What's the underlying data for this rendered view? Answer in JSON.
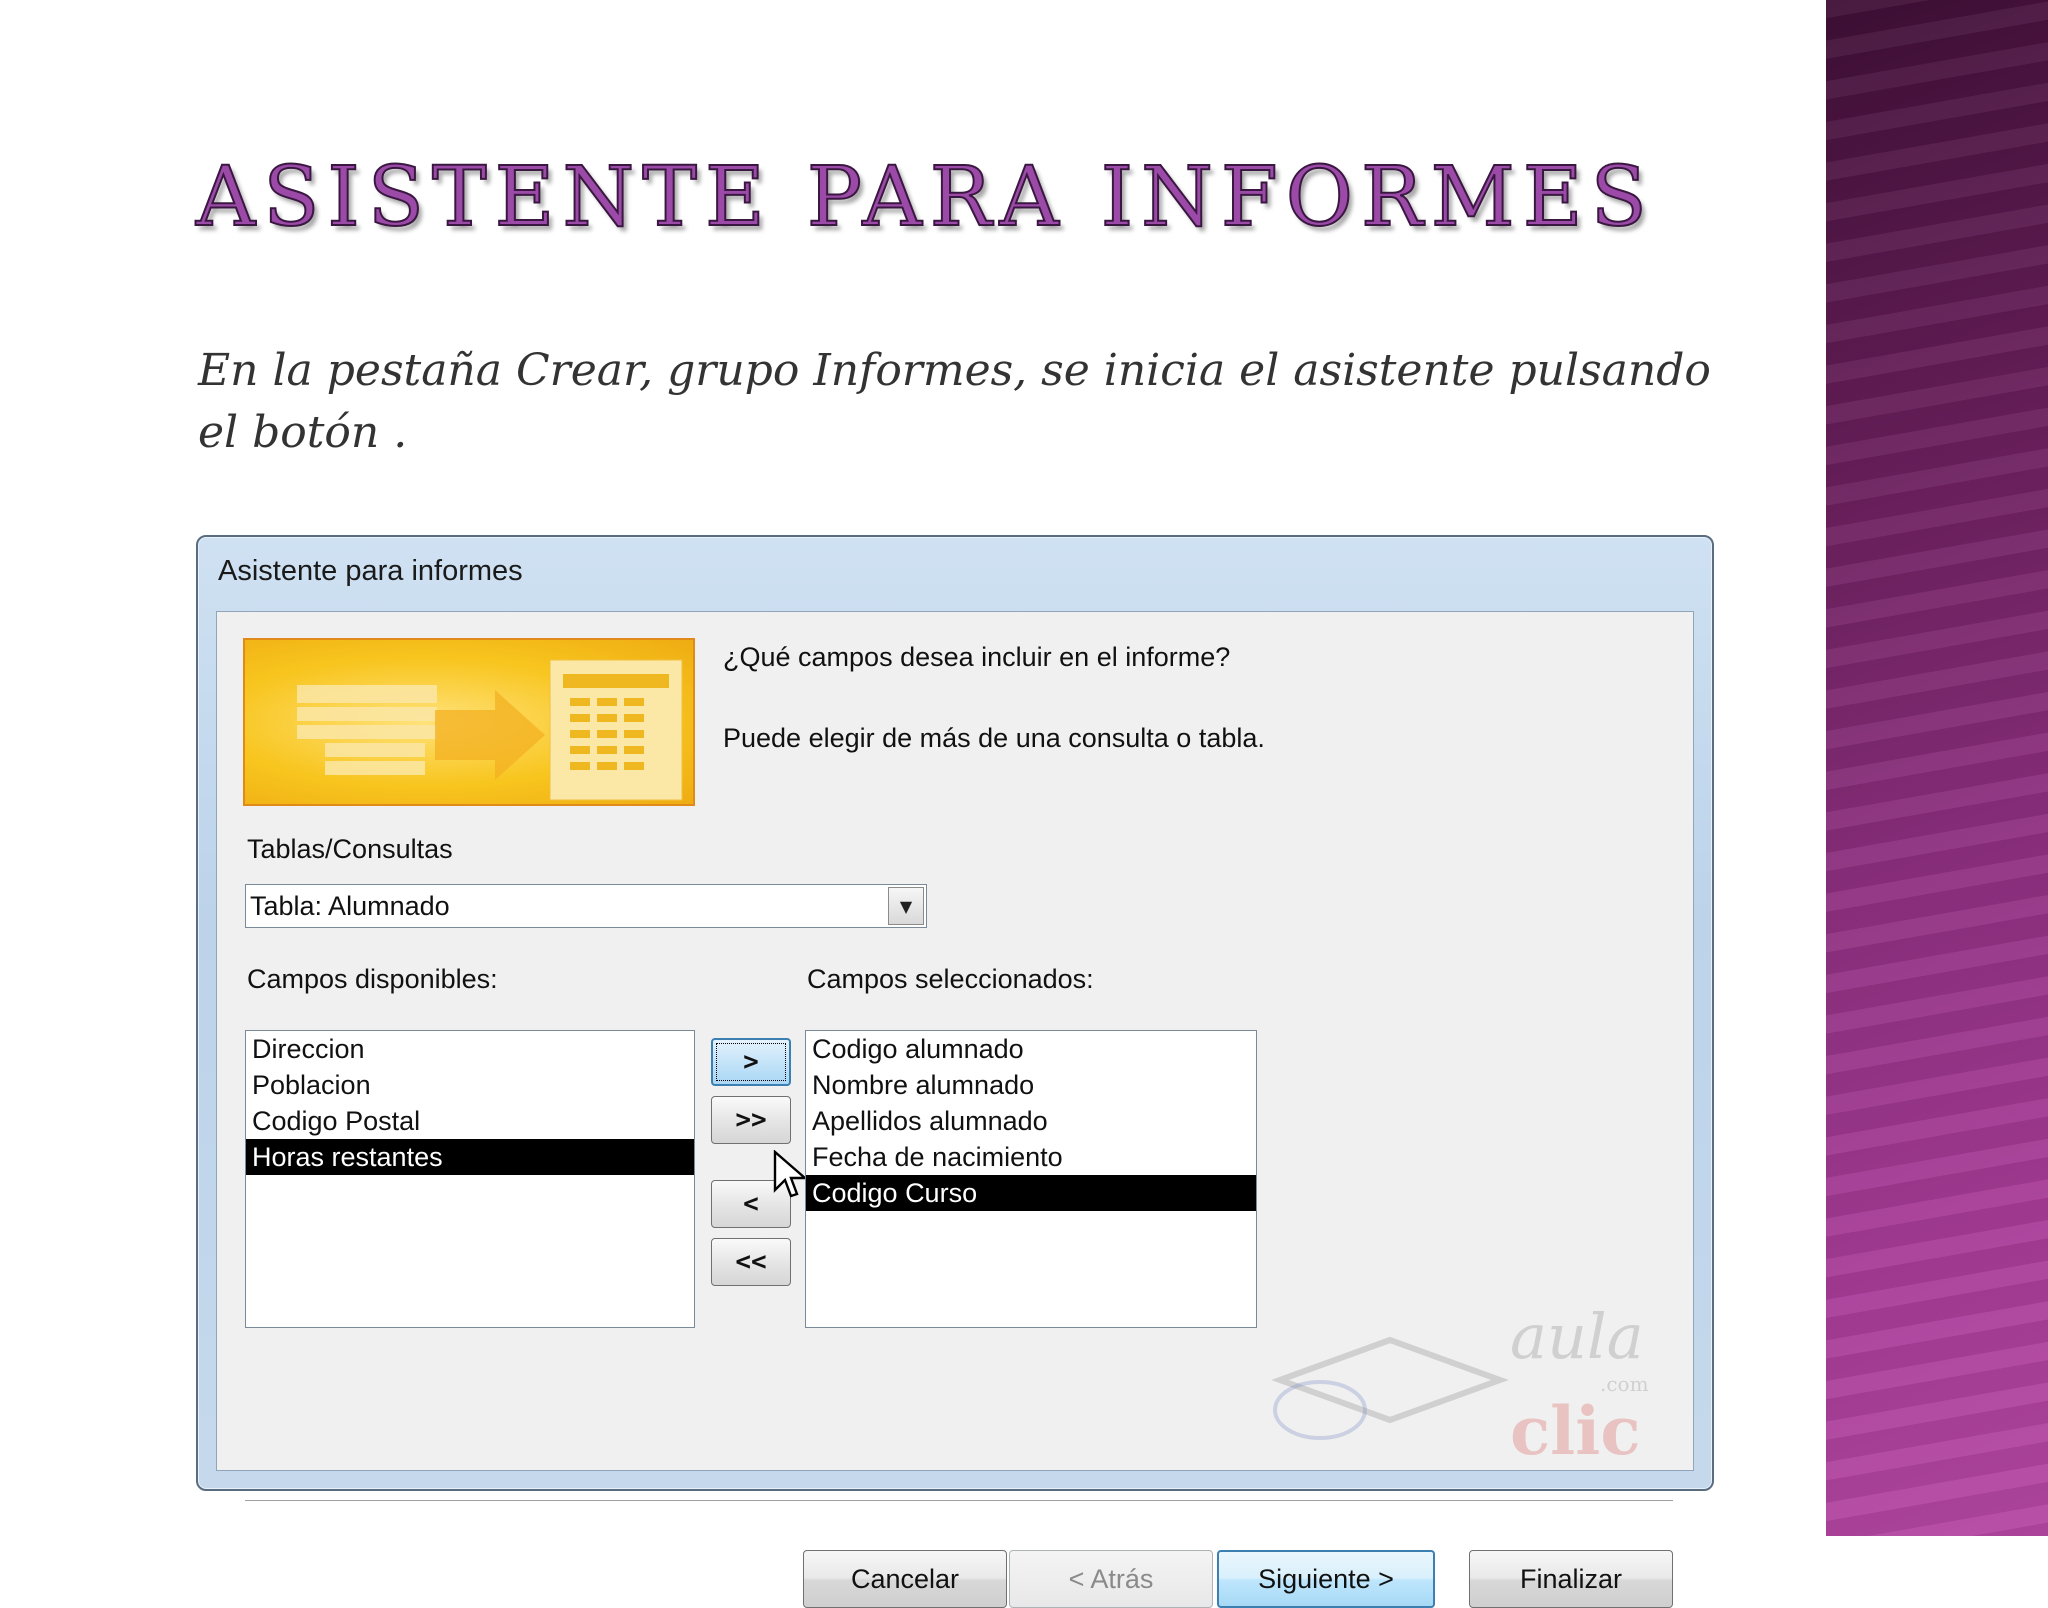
{
  "slide": {
    "title": "Asistente  para informes",
    "body": "En la pestaña Crear, grupo Informes, se inicia el asistente pulsando el botón ."
  },
  "dialog": {
    "title": "Asistente para informes",
    "question": "¿Qué campos desea incluir en el informe?",
    "hint": "Puede elegir de más de una consulta o tabla.",
    "tables_label": "Tablas/Consultas",
    "tables_value": "Tabla: Alumnado",
    "available_label": "Campos disponibles:",
    "selected_label": "Campos seleccionados:",
    "available_fields": [
      "Direccion",
      "Poblacion",
      "Codigo Postal",
      "Horas restantes"
    ],
    "available_selected_index": 3,
    "selected_fields": [
      "Codigo alumnado",
      "Nombre alumnado",
      "Apellidos alumnado",
      "Fecha de nacimiento",
      "Codigo Curso"
    ],
    "selected_selected_index": 4,
    "buttons": {
      "add_one": ">",
      "add_all": ">>",
      "remove_one": "<",
      "remove_all": "<<",
      "cancel": "Cancelar",
      "back": "< Atrás",
      "next": "Siguiente >",
      "finish": "Finalizar"
    }
  },
  "watermark": {
    "aula": "aula",
    "com": ".com",
    "clic": "clic"
  },
  "colors": {
    "accent_purple": "#9b4aa8",
    "banner_orange": "#f8c51e",
    "selection": "#000000"
  }
}
